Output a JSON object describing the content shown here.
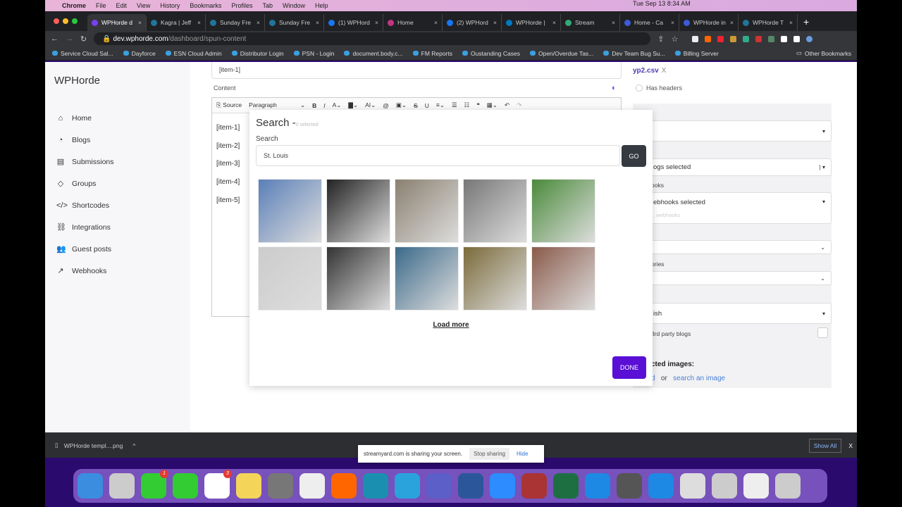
{
  "menubar": {
    "app": "Chrome",
    "items": [
      "File",
      "Edit",
      "View",
      "History",
      "Bookmarks",
      "Profiles",
      "Tab",
      "Window",
      "Help"
    ],
    "clock": "Tue Sep 13  8:34 AM"
  },
  "tabs": [
    {
      "title": "WPHorde d",
      "color": "#7b3ff2"
    },
    {
      "title": "Kagra | Jeff",
      "color": "#21759b"
    },
    {
      "title": "Sunday Fre",
      "color": "#21759b"
    },
    {
      "title": "Sunday Fre",
      "color": "#21759b"
    },
    {
      "title": "(1) WPHord",
      "color": "#1877f2"
    },
    {
      "title": "Home",
      "color": "#c13584"
    },
    {
      "title": "(2) WPHord",
      "color": "#1877f2"
    },
    {
      "title": "WPHorde |",
      "color": "#0079bf"
    },
    {
      "title": "Stream",
      "color": "#3a7"
    },
    {
      "title": "Home - Ca",
      "color": "#3b5bdb"
    },
    {
      "title": "WPHorde in",
      "color": "#3b5bdb"
    },
    {
      "title": "WPHorde T",
      "color": "#21759b"
    }
  ],
  "address": {
    "domain": "dev.wphorde.com",
    "path": "/dashboard/spun-content"
  },
  "bookmarks": [
    "Service Cloud Sal...",
    "Dayforce",
    "ESN Cloud Admin",
    "Distributor Login",
    "PSN - Login",
    "document.body.c...",
    "FM Reports",
    "Oustanding Cases",
    "Open/Overdue Tas...",
    "Dev Team Bug Su...",
    "Billing Server"
  ],
  "other_bookmarks": "Other Bookmarks",
  "sidebar": {
    "brand": "WPHorde",
    "items": [
      {
        "label": "Home",
        "icon": "⌂"
      },
      {
        "label": "Blogs",
        "icon": "◔"
      },
      {
        "label": "Submissions",
        "icon": "▤"
      },
      {
        "label": "Groups",
        "icon": "◇"
      },
      {
        "label": "Shortcodes",
        "icon": "</>"
      },
      {
        "label": "Integrations",
        "icon": "⛓"
      },
      {
        "label": "Guest posts",
        "icon": "👥"
      },
      {
        "label": "Webhooks",
        "icon": "↗"
      }
    ]
  },
  "main": {
    "title_value": "[item-1]",
    "content_label": "Content",
    "toolbar": {
      "source": "Source",
      "paragraph": "Paragraph"
    },
    "items": [
      "[item-1]",
      "[item-2]",
      "[item-3]",
      "[item-4]",
      "[item-5]"
    ]
  },
  "right": {
    "csv": "yp2.csv",
    "csv_remove": "X",
    "has_headers": "Has headers",
    "blogs": "ogs selected",
    "webhooks_label": "ooks",
    "webhooks": "ebhooks selected",
    "webhooks_hint": ": webhooks",
    "categories_label": "ories",
    "language": "ish",
    "third_party": "3rd party blogs",
    "selected_images": "cted images:",
    "upload": "d",
    "or": "or",
    "search_image": "search an image"
  },
  "modal": {
    "title": "Search -",
    "selected": "0 selected",
    "search_label": "Search",
    "search_value": "St. Louis",
    "go": "GO",
    "load_more": "Load more",
    "done": "DONE",
    "images": [
      "#5a7fb8",
      "#222",
      "#8a8070",
      "#777",
      "#4a8a3a",
      "#ccc",
      "#333",
      "#3b6a8a",
      "#7a6a3a",
      "#8a5a4a"
    ]
  },
  "download": {
    "file": "WPHorde templ....png",
    "show_all": "Show All",
    "close": "X"
  },
  "share": {
    "text": "streamyard.com is sharing your screen.",
    "stop": "Stop sharing",
    "hide": "Hide"
  },
  "dock": {
    "messages_badge": "1",
    "calendar_badge": "3",
    "apps": [
      "#3b8de0",
      "#ccc",
      "#3c3",
      "#3c3",
      "#fff",
      "#f5d45a",
      "#777",
      "#eee",
      "#f60",
      "#1b8fb0",
      "#2aa3dd",
      "#5b5fc7",
      "#2b579a",
      "#2d8cff",
      "#a33",
      "#1d6f42",
      "#1e88e5",
      "#555",
      "#1e88e5",
      "#ddd",
      "#ccc",
      "#eee",
      "#ccc"
    ]
  }
}
